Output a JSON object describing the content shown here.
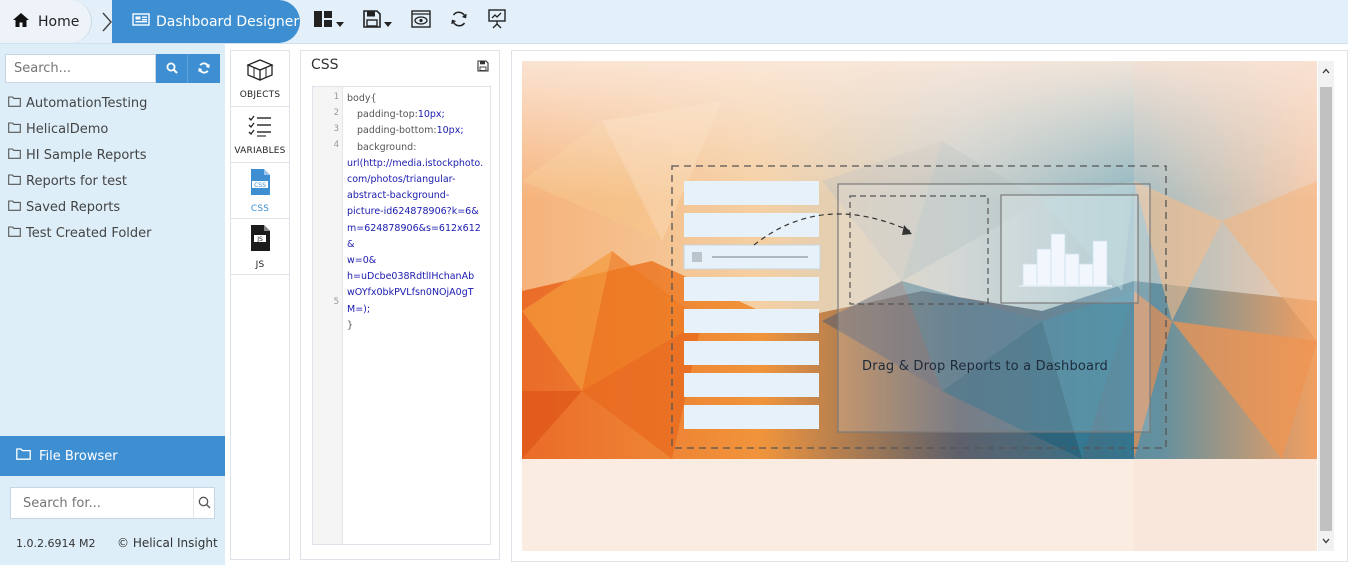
{
  "breadcrumb": {
    "home_label": "Home",
    "current_label": "Dashboard Designer"
  },
  "toolbar": {
    "icons": [
      "layout-icon",
      "save-icon",
      "preview-icon",
      "refresh-icon",
      "present-icon"
    ]
  },
  "sidebar": {
    "search_placeholder": "Search...",
    "folders": [
      {
        "label": "AutomationTesting"
      },
      {
        "label": "HelicalDemo"
      },
      {
        "label": "HI Sample Reports"
      },
      {
        "label": "Reports for test"
      },
      {
        "label": "Saved Reports"
      },
      {
        "label": "Test Created Folder"
      }
    ],
    "file_browser_label": "File Browser",
    "search_for_placeholder": "Search for...",
    "version": "1.0.2.6914 M2",
    "brand": "© Helical Insight"
  },
  "icon_panel": {
    "items": [
      {
        "label": "OBJECTS"
      },
      {
        "label": "VARIABLES"
      },
      {
        "label": "CSS"
      },
      {
        "label": "JS"
      }
    ]
  },
  "css_panel": {
    "title": "CSS",
    "line_numbers": [
      "1",
      "2",
      "3",
      "4",
      "5"
    ],
    "code": {
      "line1": "body{",
      "line2_prop": "padding-top:",
      "line2_val": "10px;",
      "line3_prop": "padding-bottom:",
      "line3_val": "10px;",
      "line4_prop": "background:",
      "url_lines": [
        "url(http://media.istockphoto.",
        "com/photos/triangular-",
        "abstract-background-",
        "picture-id624878906?k=6&",
        "m=624878906&s=612x612&",
        "w=0&",
        "h=uDcbe038RdtlIHchanAb",
        "wOYfx0bkPVLfsn0NOjA0gT",
        "M=);"
      ],
      "line5": "}"
    }
  },
  "preview": {
    "drag_drop_text": "Drag & Drop Reports to a Dashboard",
    "colors": {
      "accent": "#3d8fd1",
      "sidebar_bg": "#ddeef9"
    }
  }
}
